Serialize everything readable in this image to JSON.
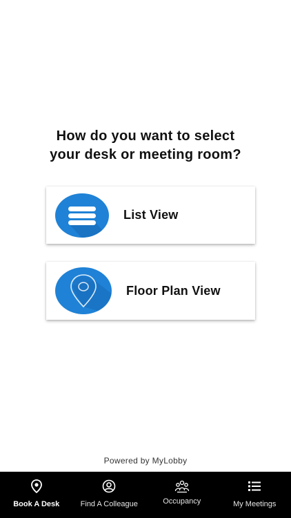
{
  "prompt": {
    "line1": "How do you want to select",
    "line2": "your desk or meeting room?"
  },
  "options": [
    {
      "label": "List View",
      "icon": "list-icon"
    },
    {
      "label": "Floor Plan View",
      "icon": "map-pin-icon"
    }
  ],
  "footer": {
    "powered_by": "Powered by MyLobby"
  },
  "tabs": [
    {
      "label": "Book A Desk",
      "icon": "location-pin-icon",
      "active": true
    },
    {
      "label": "Find A Colleague",
      "icon": "user-circle-icon",
      "active": false
    },
    {
      "label": "Occupancy",
      "icon": "people-group-icon",
      "active": false
    },
    {
      "label": "My Meetings",
      "icon": "list-bullets-icon",
      "active": false
    }
  ],
  "colors": {
    "icon_blue": "#1f7fd3",
    "icon_blue_dark": "#1a6fbf",
    "tabbar_bg": "#000000"
  }
}
